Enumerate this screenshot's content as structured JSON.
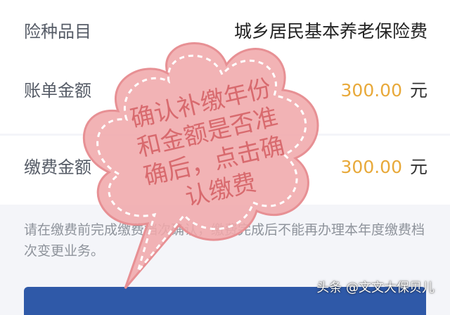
{
  "insurance_type": {
    "label": "险种品目",
    "value": "城乡居民基本养老保险费"
  },
  "bill_amount": {
    "label": "账单金额",
    "value": "300.00",
    "unit": "元"
  },
  "payment_amount": {
    "label": "缴费金额",
    "value": "300.00",
    "unit": "元"
  },
  "notice": "请在缴费前完成缴费档次确认，缴费完成后不能再办理本年度缴费档次变更业务。",
  "callout": {
    "lines": [
      "确认补缴年份",
      "和金额是否准",
      "确后，点击确",
      "认缴费"
    ]
  },
  "watermark": "头条 @文文大保贝儿",
  "colors": {
    "amount": "#e8a93a",
    "button": "#2f59a8",
    "callout_fill": "#f0a8ab",
    "callout_text": "#d86a6e"
  }
}
